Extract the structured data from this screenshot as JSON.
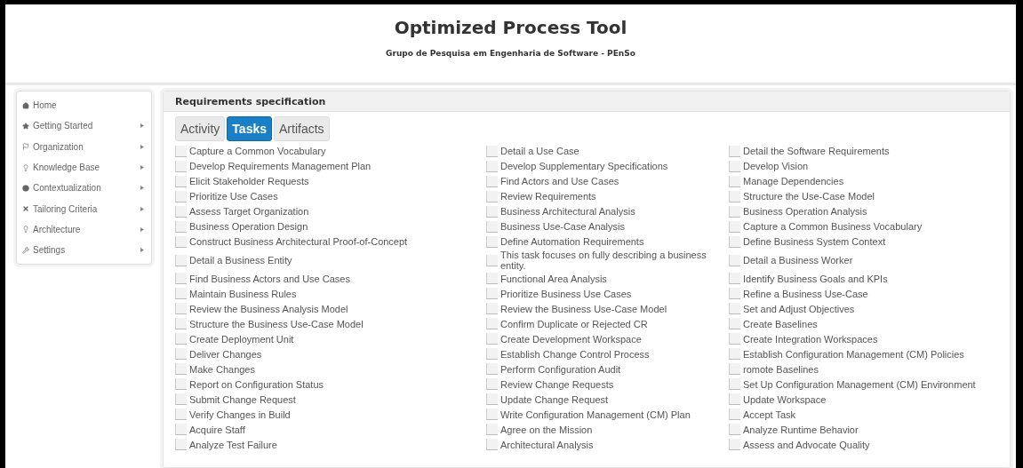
{
  "header": {
    "title": "Optimized Process Tool",
    "subtitle": "Grupo de Pesquisa em Engenharia de Software - PEnSo"
  },
  "sidebar": {
    "items": [
      {
        "label": "Home",
        "has_submenu": false
      },
      {
        "label": "Getting Started",
        "has_submenu": true
      },
      {
        "label": "Organization",
        "has_submenu": true
      },
      {
        "label": "Knowledge Base",
        "has_submenu": true
      },
      {
        "label": "Contextualization",
        "has_submenu": true
      },
      {
        "label": "Tailoring Criteria",
        "has_submenu": true
      },
      {
        "label": "Architecture",
        "has_submenu": true
      },
      {
        "label": "Settings",
        "has_submenu": true
      }
    ]
  },
  "panel": {
    "title": "Requirements specification",
    "tabs": [
      {
        "label": "Activity",
        "selected": false
      },
      {
        "label": "Tasks",
        "selected": true
      },
      {
        "label": "Artifacts",
        "selected": false
      }
    ],
    "tasks": [
      {
        "label": "Capture a Common Vocabulary",
        "checked": false
      },
      {
        "label": "Detail a Use Case",
        "checked": false
      },
      {
        "label": "Detail the Software Requirements",
        "checked": false
      },
      {
        "label": "Develop Requirements Management Plan",
        "checked": false
      },
      {
        "label": "Develop Supplementary Specifications",
        "checked": false
      },
      {
        "label": "Develop Vision",
        "checked": false
      },
      {
        "label": "Elicit Stakeholder Requests",
        "checked": false
      },
      {
        "label": "Find Actors and Use Cases",
        "checked": false
      },
      {
        "label": "Manage Dependencies",
        "checked": false
      },
      {
        "label": "Prioritize Use Cases",
        "checked": false
      },
      {
        "label": "Review Requirements",
        "checked": false
      },
      {
        "label": "Structure the Use-Case Model",
        "checked": false
      },
      {
        "label": "Assess Target Organization",
        "checked": false
      },
      {
        "label": "Business Architectural Analysis",
        "checked": false
      },
      {
        "label": "Business Operation Analysis",
        "checked": false
      },
      {
        "label": "Business Operation Design",
        "checked": false
      },
      {
        "label": "Business Use-Case Analysis",
        "checked": false
      },
      {
        "label": "Capture a Common Business Vocabulary",
        "checked": false
      },
      {
        "label": "Construct Business Architectural Proof-of-Concept",
        "checked": false
      },
      {
        "label": "Define Automation Requirements",
        "checked": false
      },
      {
        "label": "Define Business System Context",
        "checked": false
      },
      {
        "label": "Detail a Business Entity",
        "checked": false
      },
      {
        "label": "This task focuses on fully describing a business entity.",
        "checked": false
      },
      {
        "label": "Detail a Business Worker",
        "checked": false
      },
      {
        "label": "Find Business Actors and Use Cases",
        "checked": false
      },
      {
        "label": "Functional Area Analysis",
        "checked": false
      },
      {
        "label": "Identify Business Goals and KPIs",
        "checked": false
      },
      {
        "label": "Maintain Business Rules",
        "checked": false
      },
      {
        "label": "Prioritize Business Use Cases",
        "checked": false
      },
      {
        "label": "Refine a Business Use-Case",
        "checked": false
      },
      {
        "label": "Review the Business Analysis Model",
        "checked": false
      },
      {
        "label": "Review the Business Use-Case Model",
        "checked": false
      },
      {
        "label": "Set and Adjust Objectives",
        "checked": false
      },
      {
        "label": "Structure the Business Use-Case Model",
        "checked": false
      },
      {
        "label": "Confirm Duplicate or Rejected CR",
        "checked": false
      },
      {
        "label": "Create Baselines",
        "checked": false
      },
      {
        "label": "Create Deployment Unit",
        "checked": false
      },
      {
        "label": "Create Development Workspace",
        "checked": false
      },
      {
        "label": "Create Integration Workspaces",
        "checked": false
      },
      {
        "label": "Deliver Changes",
        "checked": false
      },
      {
        "label": "Establish Change Control Process",
        "checked": false
      },
      {
        "label": "Establish Configuration Management (CM) Policies",
        "checked": false
      },
      {
        "label": "Make Changes",
        "checked": false
      },
      {
        "label": "Perform Configuration Audit",
        "checked": false
      },
      {
        "label": "romote Baselines",
        "checked": false
      },
      {
        "label": "Report on Configuration Status",
        "checked": false
      },
      {
        "label": "Review Change Requests",
        "checked": false
      },
      {
        "label": "Set Up Configuration Management (CM) Environment",
        "checked": false
      },
      {
        "label": "Submit Change Request",
        "checked": false
      },
      {
        "label": "Update Change Request",
        "checked": false
      },
      {
        "label": "Update Workspace",
        "checked": false
      },
      {
        "label": "Verify Changes in Build",
        "checked": false
      },
      {
        "label": "Write Configuration Management (CM) Plan",
        "checked": false
      },
      {
        "label": "Accept Task",
        "checked": false
      },
      {
        "label": "Acquire Staff",
        "checked": false
      },
      {
        "label": "Agree on the Mission",
        "checked": false
      },
      {
        "label": "Analyze Runtime Behavior",
        "checked": false
      },
      {
        "label": "Analyze Test Failure",
        "checked": false
      },
      {
        "label": "Architectural Analysis",
        "checked": false
      },
      {
        "label": "Assess and Advocate Quality",
        "checked": false
      }
    ]
  }
}
